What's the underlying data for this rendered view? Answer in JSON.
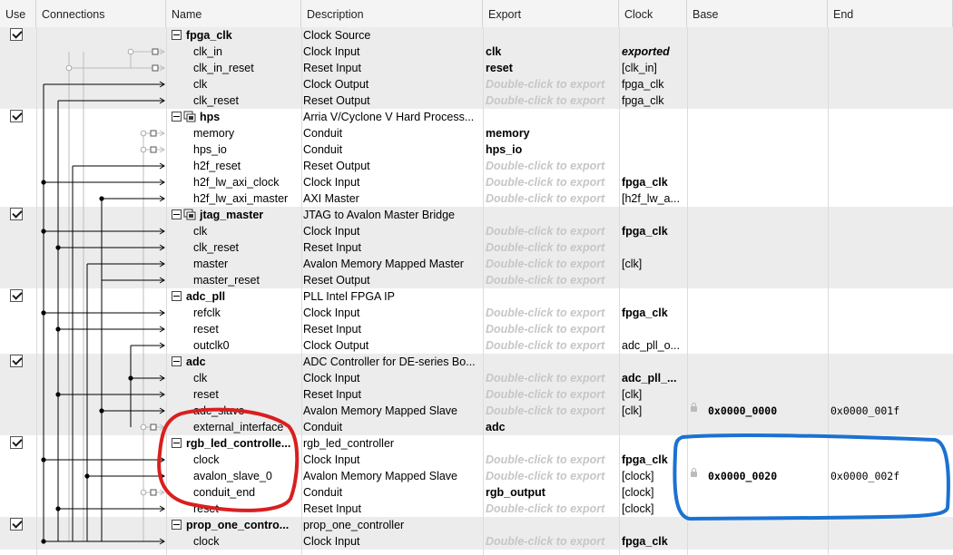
{
  "headers": {
    "use": "Use",
    "connections": "Connections",
    "name": "Name",
    "description": "Description",
    "export": "Export",
    "clock": "Clock",
    "base": "Base",
    "end": "End"
  },
  "colors": {
    "red_annotation": "#d91f1f",
    "blue_annotation": "#1a72d1",
    "hint_text": "#c6c6c6",
    "row_shade": "#ececec"
  },
  "rows": [
    {
      "type": "component",
      "checked": true,
      "icon": "",
      "name": "fpga_clk",
      "description": "Clock Source",
      "export": "",
      "clock": "",
      "base": "",
      "end": ""
    },
    {
      "type": "port",
      "name": "clk_in",
      "description": "Clock Input",
      "export": "clk",
      "export_style": "bold",
      "clock": "exported",
      "clock_style": "italic-b",
      "base": "",
      "end": ""
    },
    {
      "type": "port",
      "name": "clk_in_reset",
      "description": "Reset Input",
      "export": "reset",
      "export_style": "bold",
      "clock": "[clk_in]",
      "clock_style": "",
      "base": "",
      "end": ""
    },
    {
      "type": "port",
      "name": "clk",
      "description": "Clock Output",
      "export": "Double-click to export",
      "export_style": "hint",
      "clock": "fpga_clk",
      "clock_style": "",
      "base": "",
      "end": ""
    },
    {
      "type": "port",
      "name": "clk_reset",
      "description": "Reset Output",
      "export": "Double-click to export",
      "export_style": "hint",
      "clock": "fpga_clk",
      "clock_style": "",
      "base": "",
      "end": ""
    },
    {
      "type": "component",
      "checked": true,
      "icon": "chip-icon",
      "name": "hps",
      "description": "Arria V/Cyclone V Hard Process...",
      "export": "",
      "clock": "",
      "base": "",
      "end": ""
    },
    {
      "type": "port",
      "name": "memory",
      "description": "Conduit",
      "export": "memory",
      "export_style": "bold",
      "clock": "",
      "clock_style": "",
      "base": "",
      "end": ""
    },
    {
      "type": "port",
      "name": "hps_io",
      "description": "Conduit",
      "export": "hps_io",
      "export_style": "bold",
      "clock": "",
      "clock_style": "",
      "base": "",
      "end": ""
    },
    {
      "type": "port",
      "name": "h2f_reset",
      "description": "Reset Output",
      "export": "Double-click to export",
      "export_style": "hint",
      "clock": "",
      "clock_style": "",
      "base": "",
      "end": ""
    },
    {
      "type": "port",
      "name": "h2f_lw_axi_clock",
      "description": "Clock Input",
      "export": "Double-click to export",
      "export_style": "hint",
      "clock": "fpga_clk",
      "clock_style": "bold",
      "base": "",
      "end": ""
    },
    {
      "type": "port",
      "name": "h2f_lw_axi_master",
      "description": "AXI Master",
      "export": "Double-click to export",
      "export_style": "hint",
      "clock": "[h2f_lw_a...",
      "clock_style": "",
      "base": "",
      "end": ""
    },
    {
      "type": "component",
      "checked": true,
      "icon": "chip-icon",
      "name": "jtag_master",
      "description": "JTAG to Avalon Master Bridge",
      "export": "",
      "clock": "",
      "base": "",
      "end": ""
    },
    {
      "type": "port",
      "name": "clk",
      "description": "Clock Input",
      "export": "Double-click to export",
      "export_style": "hint",
      "clock": "fpga_clk",
      "clock_style": "bold",
      "base": "",
      "end": ""
    },
    {
      "type": "port",
      "name": "clk_reset",
      "description": "Reset Input",
      "export": "Double-click to export",
      "export_style": "hint",
      "clock": "",
      "clock_style": "",
      "base": "",
      "end": ""
    },
    {
      "type": "port",
      "name": "master",
      "description": "Avalon Memory Mapped Master",
      "export": "Double-click to export",
      "export_style": "hint",
      "clock": "[clk]",
      "clock_style": "",
      "base": "",
      "end": ""
    },
    {
      "type": "port",
      "name": "master_reset",
      "description": "Reset Output",
      "export": "Double-click to export",
      "export_style": "hint",
      "clock": "",
      "clock_style": "",
      "base": "",
      "end": ""
    },
    {
      "type": "component",
      "checked": true,
      "icon": "",
      "name": "adc_pll",
      "description": "PLL Intel FPGA IP",
      "export": "",
      "clock": "",
      "base": "",
      "end": ""
    },
    {
      "type": "port",
      "name": "refclk",
      "description": "Clock Input",
      "export": "Double-click to export",
      "export_style": "hint",
      "clock": "fpga_clk",
      "clock_style": "bold",
      "base": "",
      "end": ""
    },
    {
      "type": "port",
      "name": "reset",
      "description": "Reset Input",
      "export": "Double-click to export",
      "export_style": "hint",
      "clock": "",
      "clock_style": "",
      "base": "",
      "end": ""
    },
    {
      "type": "port",
      "name": "outclk0",
      "description": "Clock Output",
      "export": "Double-click to export",
      "export_style": "hint",
      "clock": "adc_pll_o...",
      "clock_style": "",
      "base": "",
      "end": ""
    },
    {
      "type": "component",
      "checked": true,
      "icon": "",
      "name": "adc",
      "description": "ADC Controller for DE-series Bo...",
      "export": "",
      "clock": "",
      "base": "",
      "end": ""
    },
    {
      "type": "port",
      "name": "clk",
      "description": "Clock Input",
      "export": "Double-click to export",
      "export_style": "hint",
      "clock": "adc_pll_...",
      "clock_style": "bold",
      "base": "",
      "end": ""
    },
    {
      "type": "port",
      "name": "reset",
      "description": "Reset Input",
      "export": "Double-click to export",
      "export_style": "hint",
      "clock": "[clk]",
      "clock_style": "",
      "base": "",
      "end": ""
    },
    {
      "type": "port",
      "name": "adc_slave",
      "description": "Avalon Memory Mapped Slave",
      "export": "Double-click to export",
      "export_style": "hint",
      "clock": "[clk]",
      "clock_style": "",
      "base": "0x0000_0000",
      "end": "0x0000_001f",
      "lock": true
    },
    {
      "type": "port",
      "name": "external_interface",
      "description": "Conduit",
      "export": "adc",
      "export_style": "bold",
      "clock": "",
      "clock_style": "",
      "base": "",
      "end": ""
    },
    {
      "type": "component",
      "checked": true,
      "icon": "",
      "name": "rgb_led_controlle...",
      "description": "rgb_led_controller",
      "export": "",
      "clock": "",
      "base": "",
      "end": ""
    },
    {
      "type": "port",
      "name": "clock",
      "description": "Clock Input",
      "export": "Double-click to export",
      "export_style": "hint",
      "clock": "fpga_clk",
      "clock_style": "bold",
      "base": "",
      "end": ""
    },
    {
      "type": "port",
      "name": "avalon_slave_0",
      "description": "Avalon Memory Mapped Slave",
      "export": "Double-click to export",
      "export_style": "hint",
      "clock": "[clock]",
      "clock_style": "",
      "base": "0x0000_0020",
      "end": "0x0000_002f",
      "lock": true
    },
    {
      "type": "port",
      "name": "conduit_end",
      "description": "Conduit",
      "export": "rgb_output",
      "export_style": "bold",
      "clock": "[clock]",
      "clock_style": "",
      "base": "",
      "end": ""
    },
    {
      "type": "port",
      "name": "reset",
      "description": "Reset Input",
      "export": "Double-click to export",
      "export_style": "hint",
      "clock": "[clock]",
      "clock_style": "",
      "base": "",
      "end": ""
    },
    {
      "type": "component",
      "checked": true,
      "icon": "",
      "name": "prop_one_contro...",
      "description": "prop_one_controller",
      "export": "",
      "clock": "",
      "base": "",
      "end": ""
    },
    {
      "type": "port",
      "name": "clock",
      "description": "Clock Input",
      "export": "Double-click to export",
      "export_style": "hint",
      "clock": "fpga_clk",
      "clock_style": "bold",
      "base": "",
      "end": ""
    }
  ]
}
